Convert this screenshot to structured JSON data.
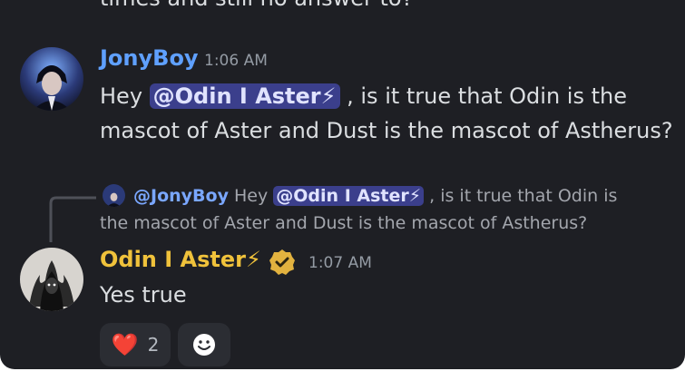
{
  "partial_top": "times and still no answer to?",
  "messages": [
    {
      "username": "JonyBoy",
      "time": "1:06 AM",
      "greeting": "Hey ",
      "mention": "@Odin I Aster⚡",
      "line1_rest": " , is it true that Odin is the",
      "line2": "mascot of Aster and Dust is the mascot of Astherus?"
    },
    {
      "reply": {
        "name": "@JonyBoy",
        "prefix": " Hey ",
        "mention": "@Odin I Aster⚡",
        "line1_rest": " , is it true that Odin is",
        "line2": "the mascot of Aster and Dust is the mascot of Astherus?"
      },
      "username": "Odin I Aster⚡",
      "time": "1:07 AM",
      "text": "Yes true",
      "reactions": [
        {
          "emoji": "❤️",
          "count": "2"
        },
        {
          "icon": "add-reaction-icon"
        }
      ]
    }
  ],
  "colors": {
    "background": "#1e1f24",
    "username_blue": "#5fa0ff",
    "username_gold": "#f0c23b",
    "text": "#dbdee1",
    "mention_bg": "#3b3f8c"
  }
}
